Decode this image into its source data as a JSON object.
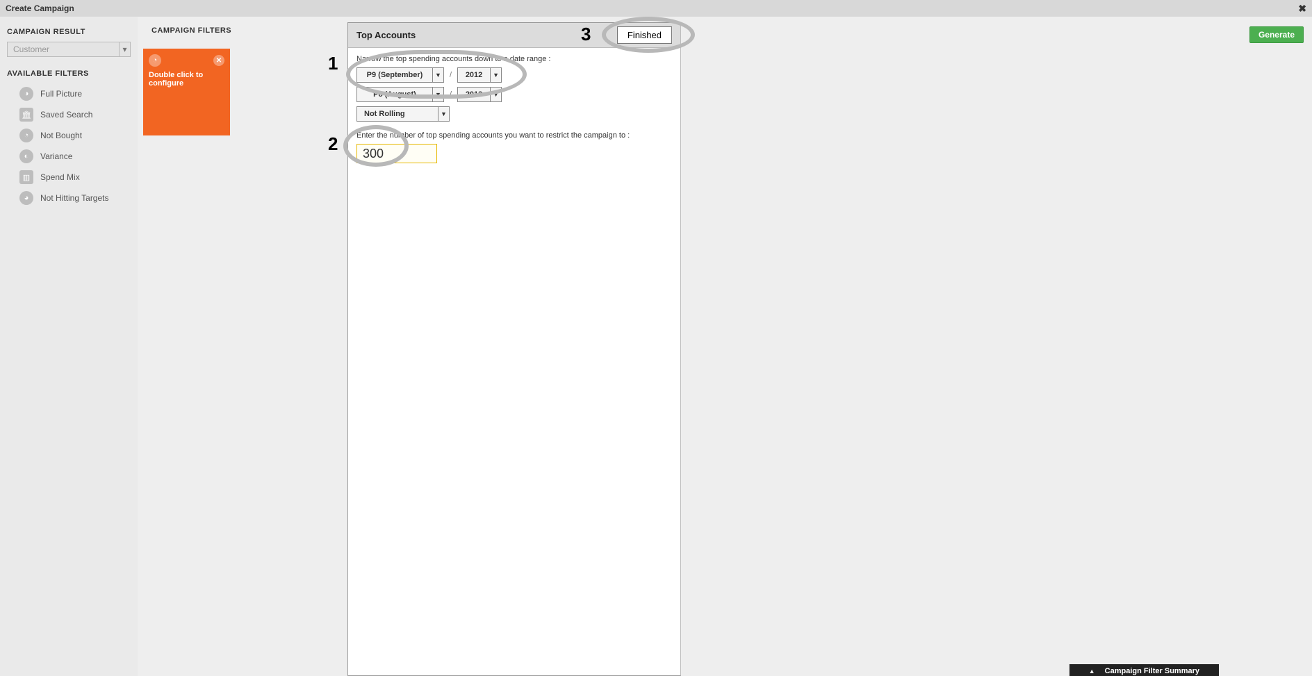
{
  "window": {
    "title": "Create Campaign",
    "close": "✖"
  },
  "sidebar": {
    "result_heading": "CAMPAIGN RESULT",
    "result_value": "Customer",
    "available_heading": "AVAILABLE FILTERS",
    "filters": [
      {
        "label": "Full Picture",
        "icon": "◑"
      },
      {
        "label": "Saved Search",
        "icon": "🏛"
      },
      {
        "label": "Not Bought",
        "icon": "◔"
      },
      {
        "label": "Variance",
        "icon": "◐"
      },
      {
        "label": "Spend Mix",
        "icon": "▥"
      },
      {
        "label": "Not Hitting Targets",
        "icon": "◕"
      }
    ]
  },
  "main": {
    "filters_heading": "CAMPAIGN FILTERS",
    "slot": {
      "icon": "◔",
      "close": "✕",
      "message": "Double click to configure"
    },
    "generate_label": "Generate"
  },
  "panel": {
    "title": "Top Accounts",
    "finished_label": "Finished",
    "date_hint": "Narrow the top spending accounts down to a date range :",
    "from_period": "P9 (September)",
    "from_year": "2012",
    "to_period": "P8 (August)",
    "to_year": "2013",
    "rolling": "Not Rolling",
    "count_hint": "Enter the number of top spending accounts you want to restrict the campaign to :",
    "count_value": "300",
    "slash": "/"
  },
  "footer": {
    "summary_label": "Campaign Filter Summary",
    "chevron": "▲"
  },
  "annotations": {
    "n1": "1",
    "n2": "2",
    "n3": "3"
  }
}
